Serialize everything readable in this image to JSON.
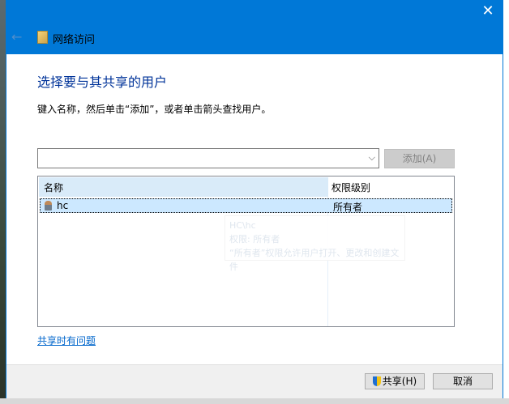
{
  "window": {
    "title": "网络访问",
    "close_icon": "close-icon",
    "back_icon": "back-arrow-icon"
  },
  "main": {
    "heading": "选择要与其共享的用户",
    "instruction": "键入名称，然后单击“添加”，或者单击箭头查找用户。",
    "name_input": {
      "value": "",
      "placeholder": ""
    },
    "add_button": "添加(A)",
    "list": {
      "columns": [
        "名称",
        "权限级别"
      ],
      "rows": [
        {
          "name": "hc",
          "permission": "所有者"
        }
      ]
    },
    "tooltip": {
      "line1": "HC\\hc",
      "line2": "权限: 所有者",
      "line3": "“所有者”权限允许用户打开、更改和创建文件"
    },
    "help_link": "共享时有问题"
  },
  "footer": {
    "share_button": "共享(H)",
    "cancel_button": "取消"
  },
  "colors": {
    "accent": "#0078d7",
    "heading": "#003399",
    "selection": "#cce8ff"
  }
}
